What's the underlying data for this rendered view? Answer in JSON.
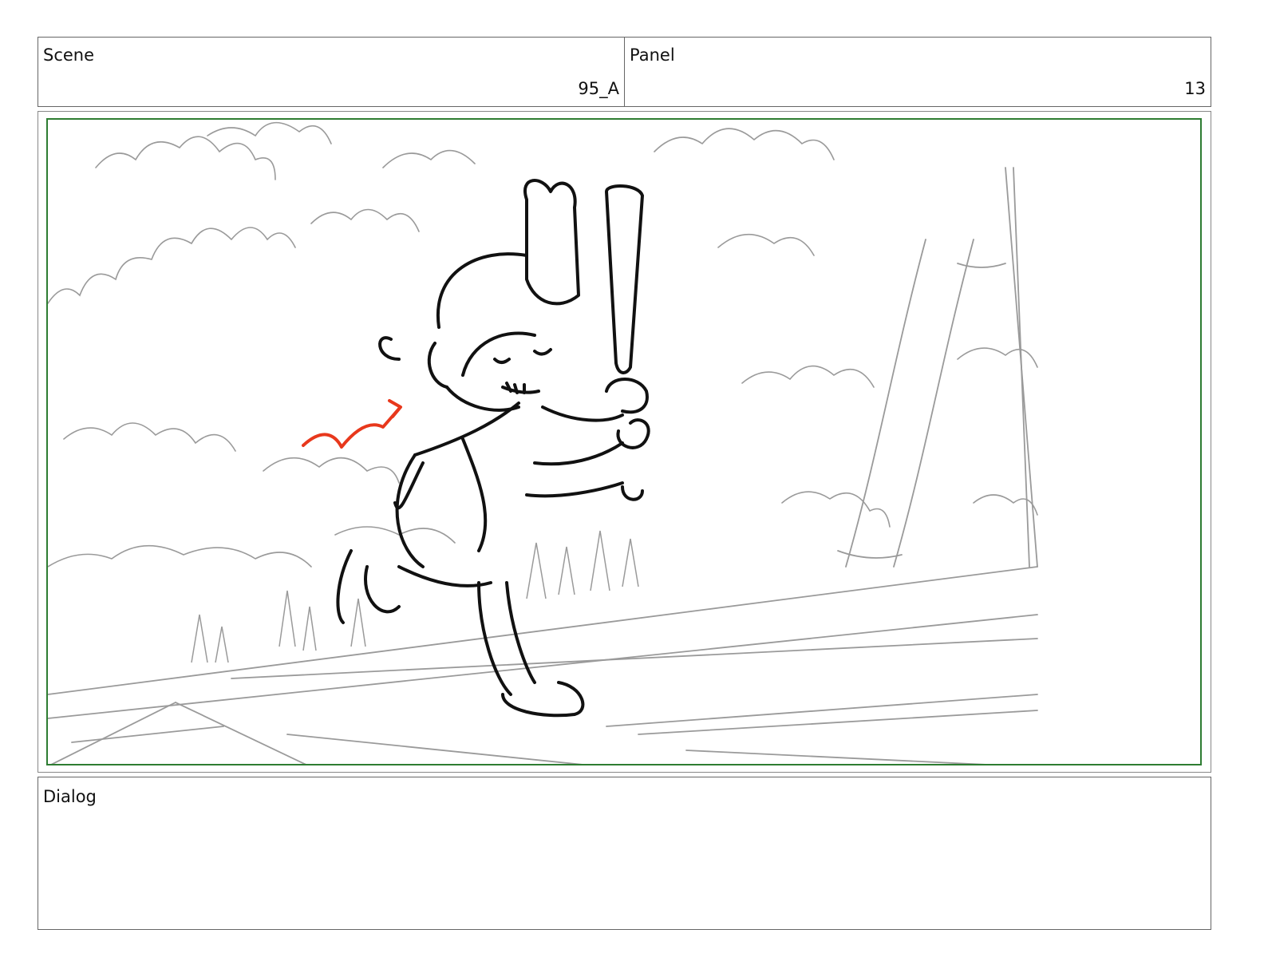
{
  "header": {
    "scene_label": "Scene",
    "scene_value": "95_A",
    "panel_label": "Panel",
    "panel_value": "13"
  },
  "frame": {
    "border_color": "#2e7d32",
    "action_arrow_color": "#e8381c",
    "content": "sketch-drawing"
  },
  "dialog": {
    "label": "Dialog",
    "text": ""
  }
}
